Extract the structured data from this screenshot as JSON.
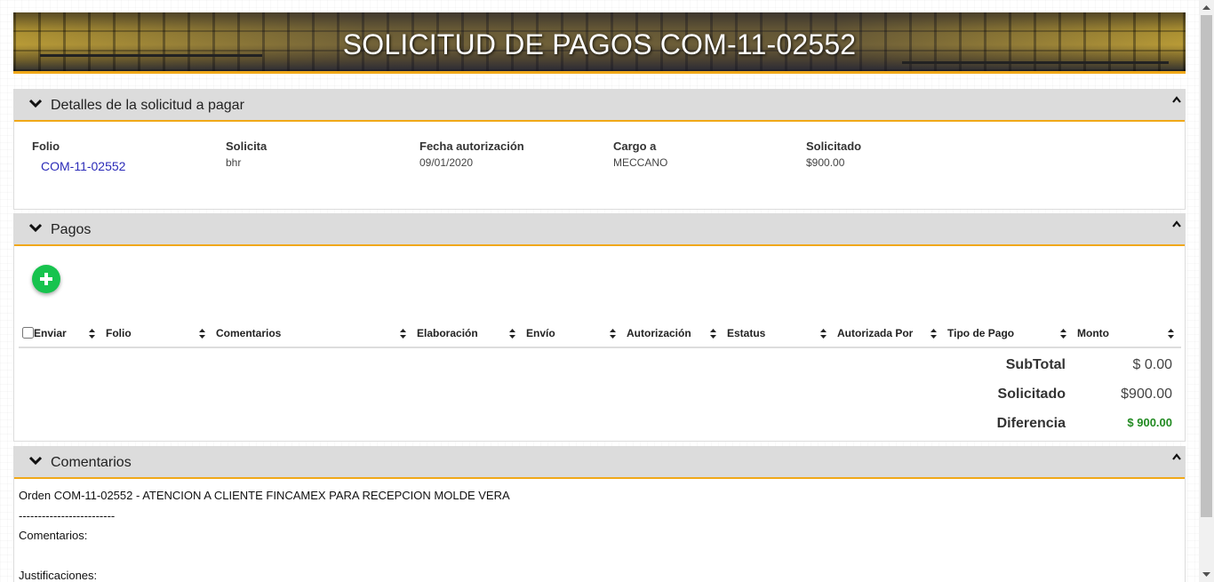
{
  "banner": {
    "title": "SOLICITUD DE PAGOS COM-11-02552"
  },
  "details": {
    "title": "Detalles de la solicitud a pagar",
    "fields": [
      {
        "label": "Folio",
        "value": "COM-11-02552"
      },
      {
        "label": "Solicita",
        "value": "bhr"
      },
      {
        "label": "Fecha autorización",
        "value": "09/01/2020"
      },
      {
        "label": "Cargo a",
        "value": "MECCANO"
      },
      {
        "label": "Solicitado",
        "value": "$900.00"
      }
    ]
  },
  "payments": {
    "title": "Pagos",
    "add_icon": "plus-icon",
    "columns": [
      "Enviar",
      "Folio",
      "Comentarios",
      "Elaboración",
      "Envío",
      "Autorización",
      "Estatus",
      "Autorizada Por",
      "Tipo de Pago",
      "Monto"
    ],
    "totals": [
      {
        "label": "SubTotal",
        "value": "$ 0.00"
      },
      {
        "label": "Solicitado",
        "value": "$900.00"
      },
      {
        "label": "Diferencia",
        "value": "$ 900.00"
      }
    ]
  },
  "comments": {
    "title": "Comentarios",
    "lines": [
      "Orden COM-11-02552 - ATENCION A CLIENTE FINCAMEX PARA RECEPCION MOLDE VERA",
      "-------------------------",
      "Comentarios:",
      "",
      "Justificaciones:"
    ]
  },
  "colors": {
    "accent": "#f0a818",
    "add_button": "#17c34e",
    "positive": "#218a21",
    "link": "#2b2bb8"
  }
}
